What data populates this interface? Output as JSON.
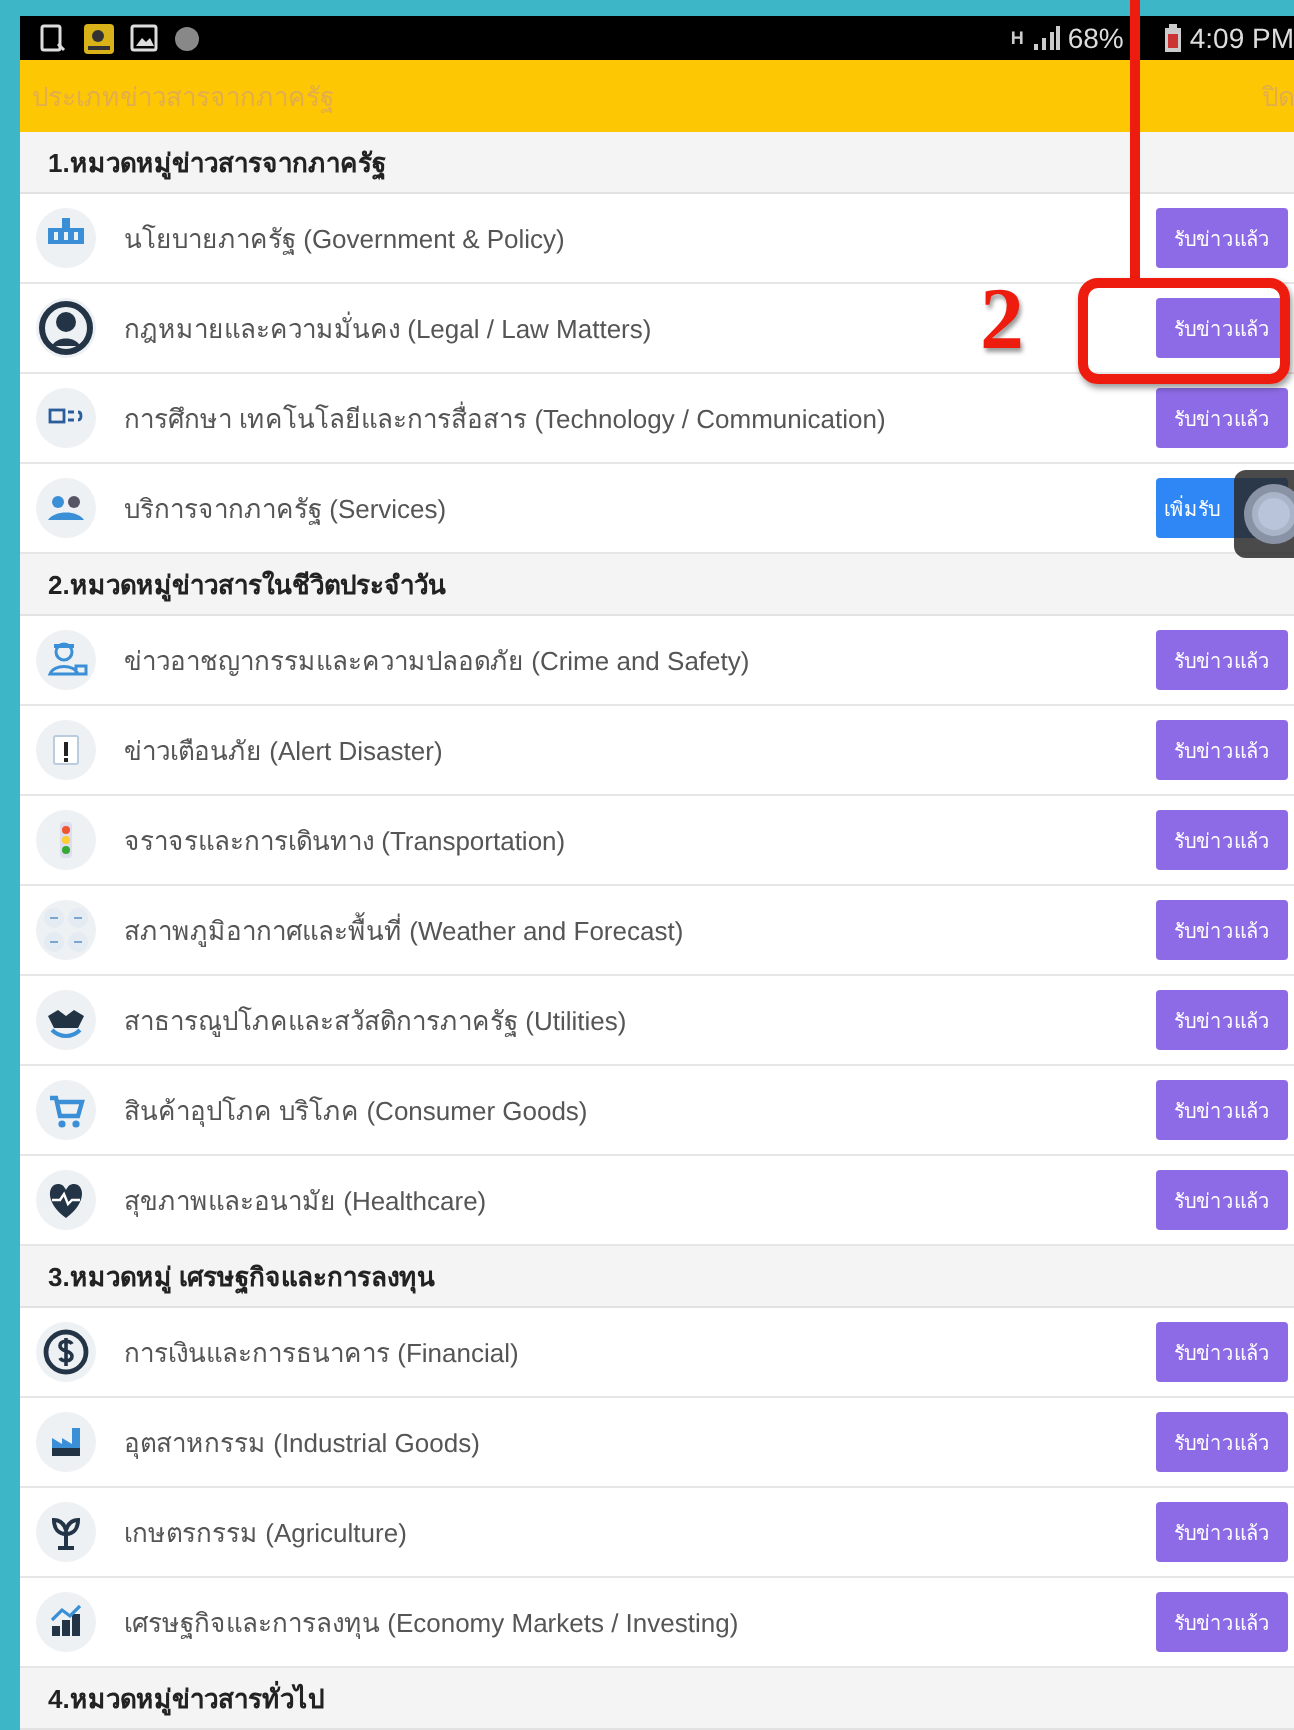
{
  "status_bar": {
    "network": "H",
    "battery": "68%",
    "time": "4:09 PM"
  },
  "header": {
    "title": "ประเภทข่าวสารจากภาครัฐ",
    "close": "ปิด"
  },
  "sections": [
    {
      "title": "1.หมวดหมู่ข่าวสารจากภาครัฐ",
      "items": [
        {
          "label": "นโยบายภาครัฐ (Government & Policy)",
          "button": "รับข่าวแล้ว",
          "subscribed": true
        },
        {
          "label": "กฎหมายและความมั่นคง (Legal / Law Matters)",
          "button": "รับข่าวแล้ว",
          "subscribed": true
        },
        {
          "label": "การศึกษา เทคโนโลยีและการสื่อสาร (Technology / Communication)",
          "button": "รับข่าวแล้ว",
          "subscribed": true
        },
        {
          "label": "บริการจากภาครัฐ (Services)",
          "button": "เพิ่มรับ",
          "subscribed": false
        }
      ]
    },
    {
      "title": "2.หมวดหมู่ข่าวสารในชีวิตประจำวัน",
      "items": [
        {
          "label": "ข่าวอาชญากรรมและความปลอดภัย (Crime and Safety)",
          "button": "รับข่าวแล้ว",
          "subscribed": true
        },
        {
          "label": "ข่าวเตือนภัย (Alert Disaster)",
          "button": "รับข่าวแล้ว",
          "subscribed": true
        },
        {
          "label": "จราจรและการเดินทาง (Transportation)",
          "button": "รับข่าวแล้ว",
          "subscribed": true
        },
        {
          "label": "สภาพภูมิอากาศและพื้นที่ (Weather and Forecast)",
          "button": "รับข่าวแล้ว",
          "subscribed": true
        },
        {
          "label": "สาธารณูปโภคและสวัสดิการภาครัฐ (Utilities)",
          "button": "รับข่าวแล้ว",
          "subscribed": true
        },
        {
          "label": "สินค้าอุปโภค บริโภค (Consumer Goods)",
          "button": "รับข่าวแล้ว",
          "subscribed": true
        },
        {
          "label": "สุขภาพและอนามัย (Healthcare)",
          "button": "รับข่าวแล้ว",
          "subscribed": true
        }
      ]
    },
    {
      "title": "3.หมวดหมู่ เศรษฐกิจและการลงทุน",
      "items": [
        {
          "label": "การเงินและการธนาคาร (Financial)",
          "button": "รับข่าวแล้ว",
          "subscribed": true
        },
        {
          "label": "อุตสาหกรรม (Industrial Goods)",
          "button": "รับข่าวแล้ว",
          "subscribed": true
        },
        {
          "label": "เกษตรกรรม (Agriculture)",
          "button": "รับข่าวแล้ว",
          "subscribed": true
        },
        {
          "label": "เศรษฐกิจและการลงทุน (Economy Markets / Investing)",
          "button": "รับข่าวแล้ว",
          "subscribed": true
        }
      ]
    },
    {
      "title": "4.หมวดหมู่ข่าวสารทั่วไป"
    }
  ],
  "annotation": {
    "number": "2"
  }
}
